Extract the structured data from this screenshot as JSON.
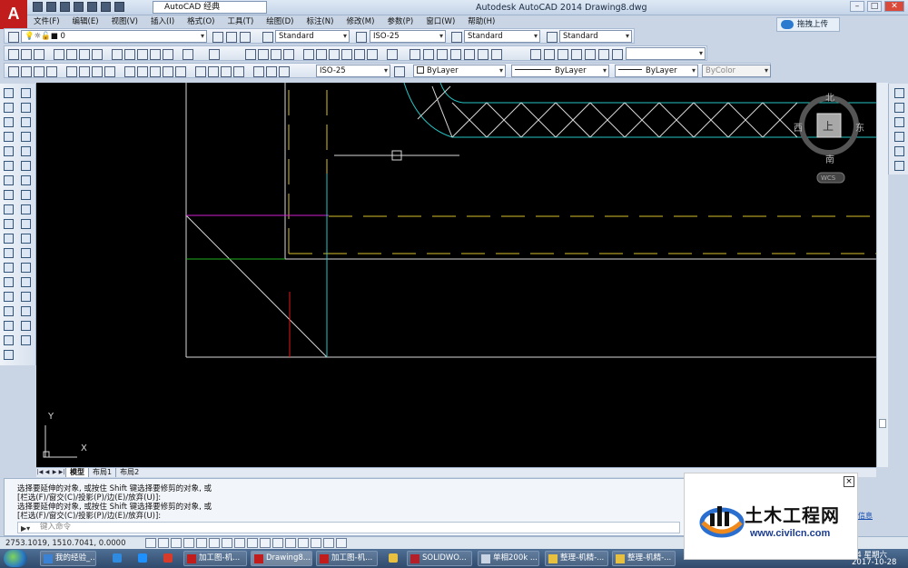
{
  "titlebar": {
    "app_logo": "A",
    "workspace": "AutoCAD 经典",
    "title": "Autodesk AutoCAD 2014    Drawing8.dwg",
    "upload_label": "拖拽上传"
  },
  "menu": [
    "文件(F)",
    "编辑(E)",
    "视图(V)",
    "插入(I)",
    "格式(O)",
    "工具(T)",
    "绘图(D)",
    "标注(N)",
    "修改(M)",
    "参数(P)",
    "窗口(W)",
    "帮助(H)"
  ],
  "toolbar": {
    "layer": "0",
    "text_style": "Standard",
    "dim_style": "ISO-25",
    "table_style": "Standard",
    "multileader_style": "Standard",
    "dim_style_2": "ISO-25",
    "color": "ByLayer",
    "linetype": "ByLayer",
    "lineweight": "ByLayer",
    "plotstyle": "ByColor"
  },
  "viewcube": {
    "north": "北",
    "south": "南",
    "east": "东",
    "west": "西",
    "top": "上",
    "wcs": "WCS"
  },
  "ucs": {
    "x": "X",
    "y": "Y"
  },
  "layout_tabs": [
    "模型",
    "布局1",
    "布局2"
  ],
  "command": {
    "line1": "选择要延伸的对象, 或按住 Shift 键选择要修剪的对象, 或",
    "line2": "[栏选(F)/窗交(C)/投影(P)/边(E)/放弃(U)]:",
    "line3": "选择要延伸的对象, 或按住 Shift 键选择要修剪的对象, 或",
    "line4": "[栏选(F)/窗交(C)/投影(P)/边(E)/放弃(U)]:",
    "placeholder": "键入命令"
  },
  "status": {
    "coords": "2753.1019,  1510.7041,  0.0000"
  },
  "taskbar": {
    "tasks": [
      "我的经验_...",
      "加工图-机...",
      "Drawing8....",
      "加工图-机...",
      "SOLIDWO...",
      "单相200k ...",
      "整理-机精-...",
      "整理-机精-..."
    ],
    "time": "44 星期六",
    "date": "2017-10-28",
    "temp": "16°C"
  },
  "watermark": {
    "name": "土木工程网",
    "url": "www.civilcn.com",
    "close": "×",
    "side_note": "信息"
  },
  "colors": {
    "canvas": "#000000",
    "white_line": "#d8d8d8",
    "yellow_line": "#d6c02a",
    "cyan_line": "#26c6c6",
    "magenta_line": "#d020d0",
    "green_line": "#20b020",
    "red_line": "#e01818"
  }
}
